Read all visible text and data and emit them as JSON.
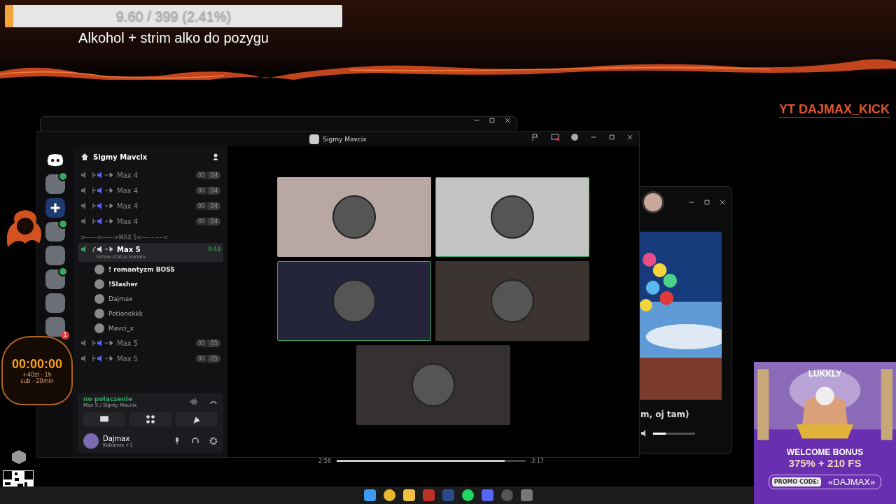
{
  "goal_bar": {
    "text": "9.60 / 399 (2.41%)",
    "level": 0.0241,
    "caption": "Alkohol + strim alko do pozygu"
  },
  "banner_text": "YT DAJMAX_KICK",
  "discord": {
    "title": "Sigmy Mavcix",
    "server_name": "Sigmy Mavcix",
    "servers": [
      {
        "kind": "avatar",
        "voice": true
      },
      {
        "kind": "add"
      },
      {
        "kind": "avatar",
        "voice": true
      },
      {
        "kind": "avatar",
        "voice": false
      },
      {
        "kind": "avatar",
        "voice": true
      },
      {
        "kind": "avatar",
        "voice": false
      },
      {
        "kind": "avatar",
        "voice": false,
        "badge": "1"
      }
    ],
    "channels": [
      {
        "kind": "voice",
        "name": "Max 4",
        "count_a": "00",
        "count_b": "04"
      },
      {
        "kind": "voice",
        "name": "Max 4",
        "count_a": "00",
        "count_b": "04"
      },
      {
        "kind": "voice",
        "name": "Max 4",
        "count_a": "00",
        "count_b": "04"
      },
      {
        "kind": "voice",
        "name": "Max 4",
        "count_a": "00",
        "count_b": "04"
      },
      {
        "kind": "category",
        "name": ">------>------>MAX 5<------ ----<"
      },
      {
        "kind": "active",
        "name": "Max 5",
        "time": "8:44",
        "status": "Ustaw status kanału",
        "users": [
          {
            "name": "! romantyzm BOSS",
            "bold": true
          },
          {
            "name": "!Slasher",
            "bold": true
          },
          {
            "name": "Dajmax",
            "bold": false
          },
          {
            "name": "Potionekkk",
            "bold": false
          },
          {
            "name": "Mavci_x",
            "bold": false
          }
        ]
      },
      {
        "kind": "voice",
        "name": "Max 5",
        "count_a": "00",
        "count_b": "05"
      },
      {
        "kind": "voice",
        "name": "Max 5",
        "count_a": "00",
        "count_b": "05"
      }
    ],
    "voice_panel": {
      "status": "no połączenie",
      "location": "Max 5 / Sigmy Mavcix"
    },
    "user": {
      "name": "Dajmax",
      "activity": "Kabanos +1"
    },
    "tiles": [
      {
        "speaking": false
      },
      {
        "speaking": true
      },
      {
        "speaking": true
      },
      {
        "speaking": false
      },
      {
        "speaking": false
      }
    ]
  },
  "player": {
    "time_elapsed": "2:56",
    "time_total": "3:17",
    "level": 0.89,
    "caption": "m, oj tam)",
    "volume": {
      "level": 0.3
    }
  },
  "timer": {
    "time": "00:00:00",
    "lines": [
      "+40zł - 1h",
      "sub - 20min"
    ]
  },
  "ad": {
    "brand": "LUKKLY",
    "headline": "WELCOME BONUS",
    "offer": "375% + 210 FS",
    "promo_label": "PROMO CODE:",
    "promo_code": "«DAJMAX»"
  }
}
